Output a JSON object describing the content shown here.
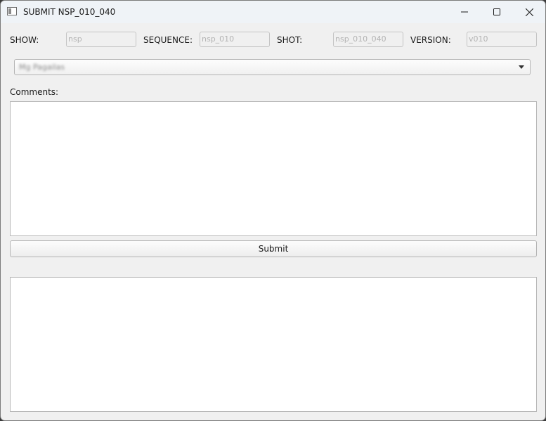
{
  "window": {
    "title": "SUBMIT NSP_010_040"
  },
  "fields": {
    "show": {
      "label": "SHOW:",
      "value": "nsp"
    },
    "sequence": {
      "label": "SEQUENCE:",
      "value": "nsp_010"
    },
    "shot": {
      "label": "SHOT:",
      "value": "nsp_010_040"
    },
    "version": {
      "label": "VERSION:",
      "value": "v010"
    }
  },
  "dropdown": {
    "selected": "Mg Pagailas"
  },
  "comments": {
    "label": "Comments:",
    "value": ""
  },
  "actions": {
    "submit_label": "Submit"
  },
  "output": {
    "value": ""
  }
}
